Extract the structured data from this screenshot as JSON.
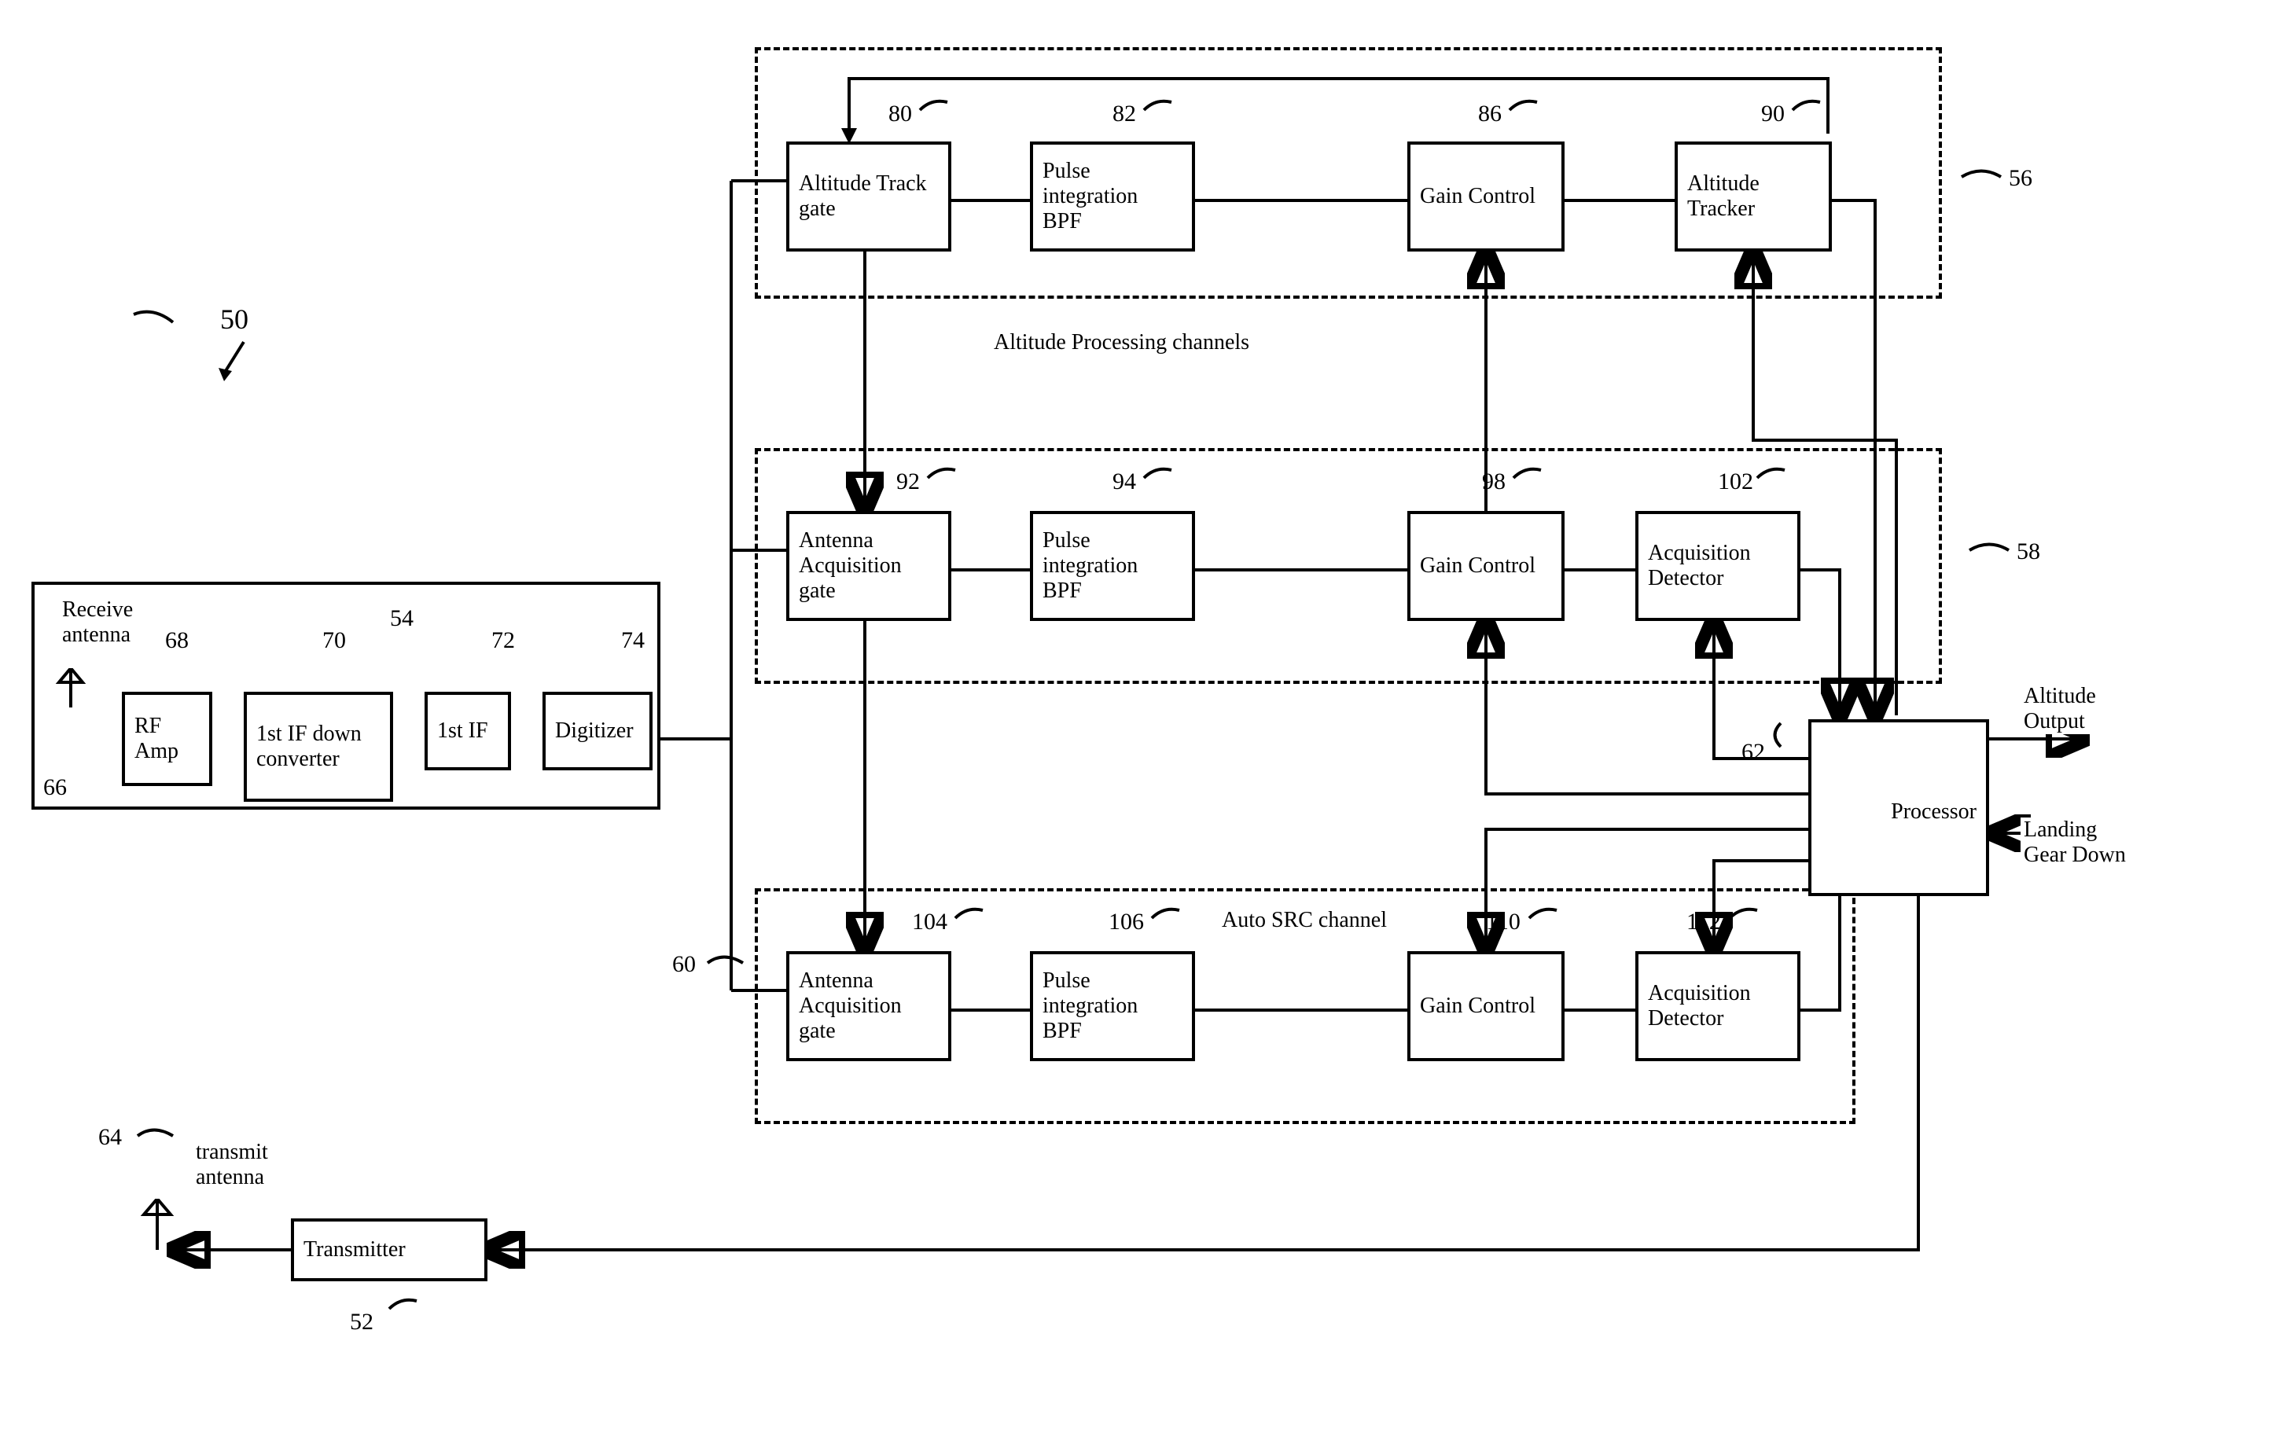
{
  "figure_ref": "50",
  "receiver_block": {
    "ref": "54",
    "label": "Receive antenna",
    "antenna_ref": "66",
    "rf_amp": {
      "ref": "68",
      "label": "RF Amp"
    },
    "if_down": {
      "ref": "70",
      "label": "1st IF down converter"
    },
    "if": {
      "ref": "72",
      "label": "1st IF"
    },
    "digitizer": {
      "ref": "74",
      "label": "Digitizer"
    }
  },
  "channel56": {
    "ref": "56",
    "b1": {
      "ref": "80",
      "label": "Altitude Track gate"
    },
    "b2": {
      "ref": "82",
      "label": "Pulse integration BPF"
    },
    "b3": {
      "ref": "86",
      "label": "Gain Control"
    },
    "b4": {
      "ref": "90",
      "label": "Altitude Tracker"
    }
  },
  "section_label": "Altitude Processing channels",
  "channel58": {
    "ref": "58",
    "b1": {
      "ref": "92",
      "label": "Antenna Acquisition gate"
    },
    "b2": {
      "ref": "94",
      "label": "Pulse integration BPF"
    },
    "b3": {
      "ref": "98",
      "label": "Gain Control"
    },
    "b4": {
      "ref": "102",
      "label": "Acquisition Detector"
    }
  },
  "channel60": {
    "ref": "60",
    "label": "Auto SRC channel",
    "b1": {
      "ref": "104",
      "label": "Antenna Acquisition gate"
    },
    "b2": {
      "ref": "106",
      "label": "Pulse integration BPF"
    },
    "b3": {
      "ref": "110",
      "label": "Gain Control"
    },
    "b4": {
      "ref": "112",
      "label": "Acquisition Detector"
    }
  },
  "processor": {
    "ref": "62",
    "label": "Processor"
  },
  "transmitter": {
    "ref": "52",
    "label": "Transmitter"
  },
  "tx_antenna": {
    "ref": "64",
    "label": "transmit antenna"
  },
  "outputs": {
    "altitude": "Altitude Output",
    "landing": "Landing Gear Down"
  }
}
